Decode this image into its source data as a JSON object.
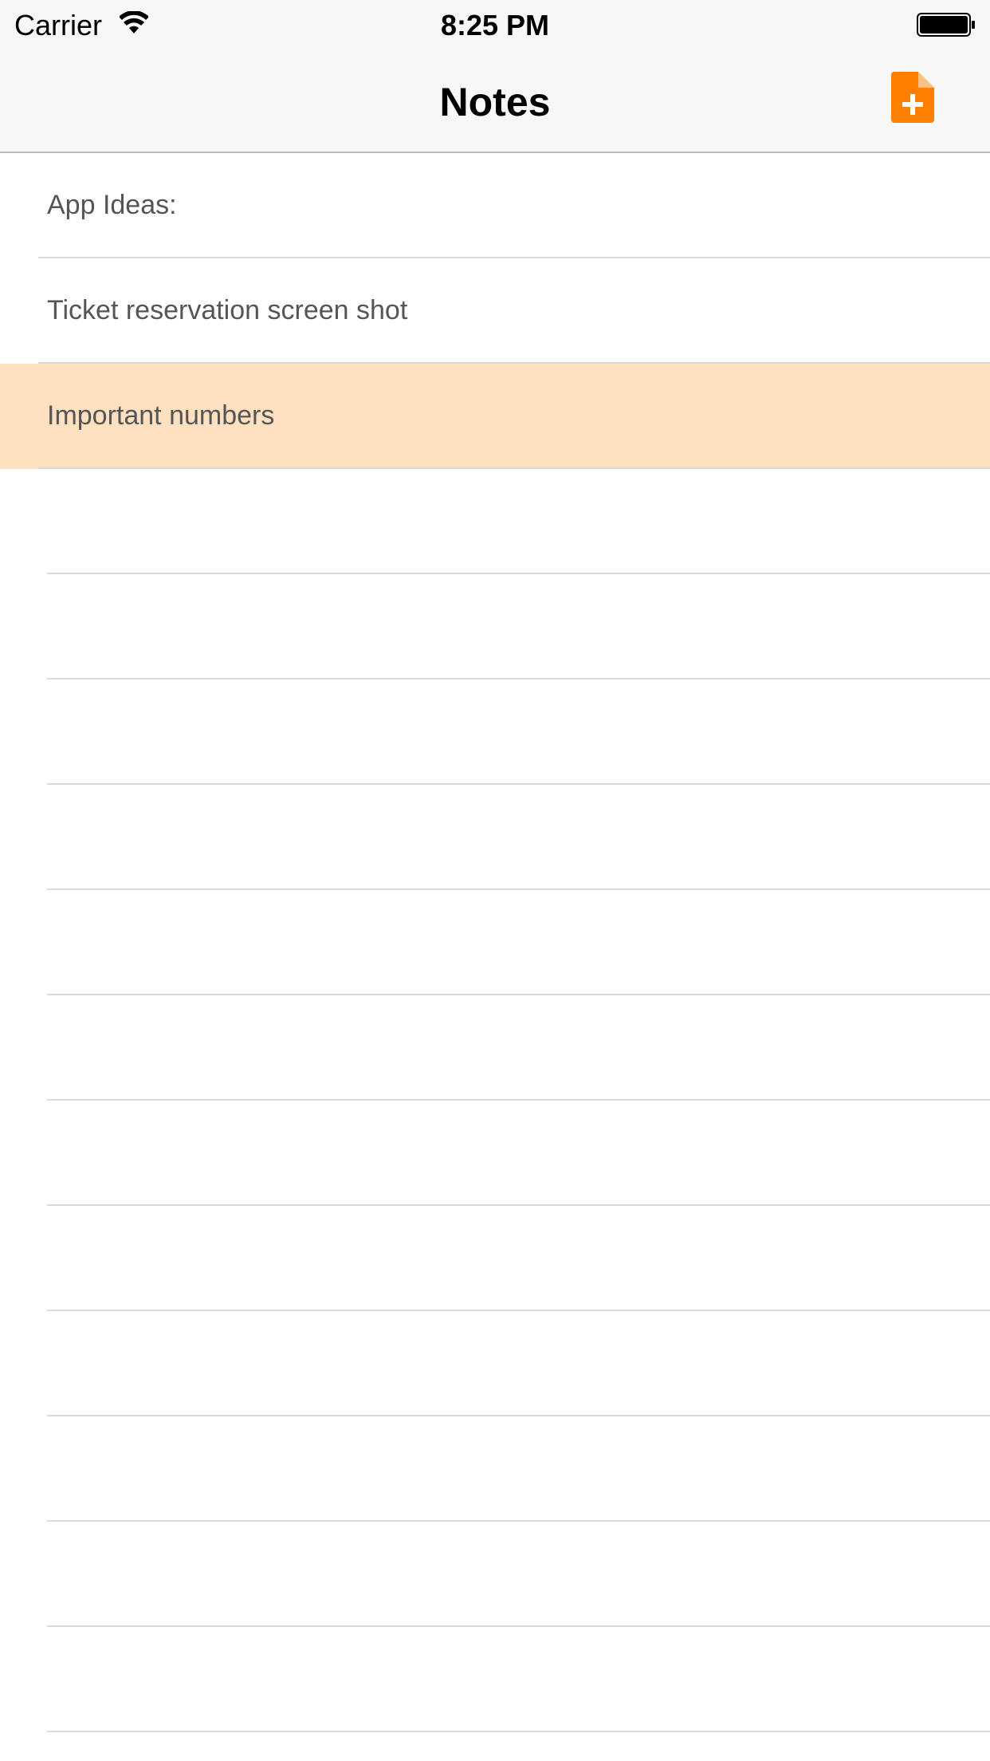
{
  "status_bar": {
    "carrier": "Carrier",
    "time": "8:25 PM",
    "wifi_icon": "wifi-icon",
    "battery_icon": "battery-icon"
  },
  "nav_bar": {
    "title": "Notes",
    "add_button_icon": "add-note-icon",
    "accent_color": "#ff8000"
  },
  "notes": [
    {
      "title": "App Ideas:",
      "selected": false
    },
    {
      "title": "Ticket reservation screen shot",
      "selected": false
    },
    {
      "title": "Important numbers",
      "selected": true
    }
  ],
  "colors": {
    "selected_row": "#ffe1c2",
    "note_text": "#555555",
    "separator": "#d9d9d9"
  }
}
